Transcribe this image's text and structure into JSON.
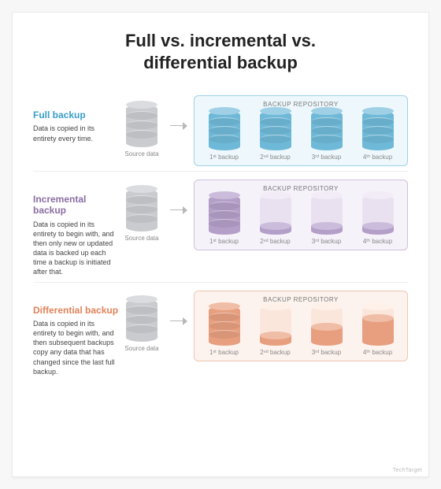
{
  "title_line1": "Full vs. incremental vs.",
  "title_line2": "differential backup",
  "repo_label": "BACKUP REPOSITORY",
  "source_label": "Source data",
  "backup_labels": [
    "1ˢᵗ backup",
    "2ⁿᵈ backup",
    "3ʳᵈ backup",
    "4ᵗʰ backup"
  ],
  "full": {
    "heading": "Full backup",
    "text": "Data is copied in its entirety every time."
  },
  "incremental": {
    "heading": "Incremental backup",
    "text": "Data is copied in its entirety to begin with, and then only new or updated data is backed up each time a backup is initiated after that."
  },
  "differential": {
    "heading": "Differential backup",
    "text": "Data is copied in its entirety to begin with, and then subsequent backups copy any data that has changed since the last full backup."
  },
  "credit_right": "TechTarget",
  "credit_left": ""
}
